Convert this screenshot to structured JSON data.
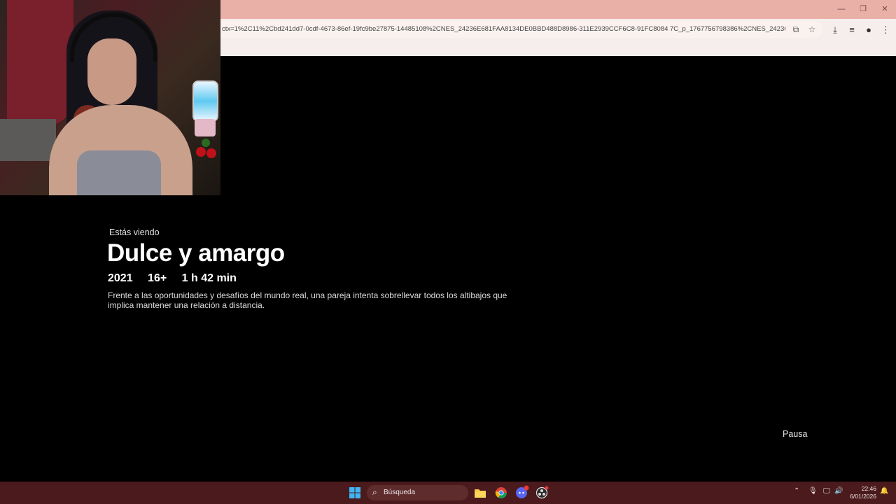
{
  "browser": {
    "url": "ctx=1%2C11%2Cbd241dd7-0cdf-4673-86ef-19fc9be27875-14485108%2CNES_24236E681FAA8134DE0BBD488D8986-311E2939CCF6C8-91FC8084 7C_p_1767756798386%2CNES_24236E681FAA81...",
    "icons": [
      "install-app-icon",
      "bookmark-star-icon",
      "download-icon",
      "media-queue-icon",
      "extension-icon",
      "menu-icon"
    ],
    "window_controls": [
      "minimize",
      "restore",
      "close"
    ]
  },
  "player": {
    "watching_label": "Estás viendo",
    "title": "Dulce y amargo",
    "year": "2021",
    "rating": "16+",
    "duration": "1 h 42 min",
    "synopsis": "Frente a las oportunidades y desafíos del mundo real, una pareja intenta sobrellevar todos los altibajos que implica mantener una relación a distancia.",
    "state_label": "Pausa"
  },
  "taskbar": {
    "search_placeholder": "Búsqueda",
    "apps": [
      "start",
      "file-explorer",
      "chrome",
      "discord",
      "obs"
    ],
    "discord_badge": "9+",
    "time": "22:46",
    "date": "6/01/2026"
  },
  "colors": {
    "chrome_titlebar": "#e9b0a8",
    "chrome_toolbar": "#f6eeec",
    "taskbar": "#4a1a1c",
    "background": "#000000"
  }
}
